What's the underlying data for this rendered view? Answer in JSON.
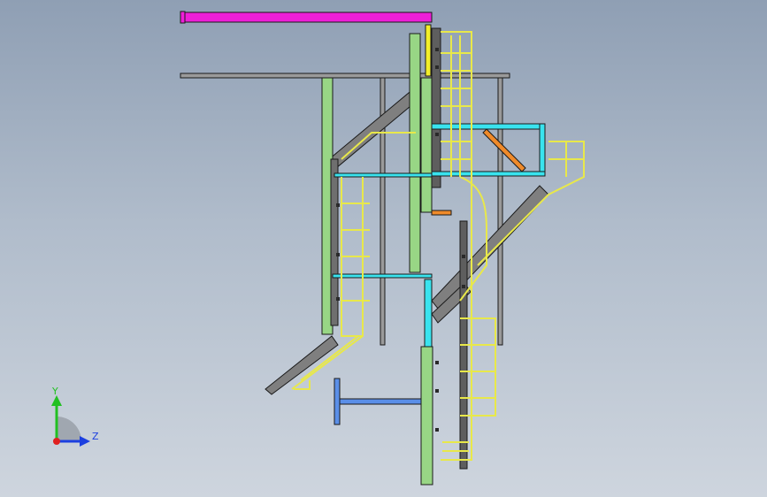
{
  "viewport": {
    "background_top": "#8f9fb4",
    "background_bottom": "#ced5de"
  },
  "model": {
    "colors": {
      "column": "#98d685",
      "brace": "#7a7a7a",
      "ladder": "#e8e84a",
      "beam_cyan": "#39e3ee",
      "beam_magenta": "#ee1fd8",
      "beam_yellow": "#f2ee2a",
      "beam_orange": "#ef8a2a",
      "beam_blue": "#5a8fe8",
      "outline": "#1a1a1a"
    }
  },
  "triad": {
    "y_label": "Y",
    "z_label": "Z",
    "y_color": "#22c022",
    "z_color": "#1c3fe0",
    "x_color": "#e02020"
  }
}
